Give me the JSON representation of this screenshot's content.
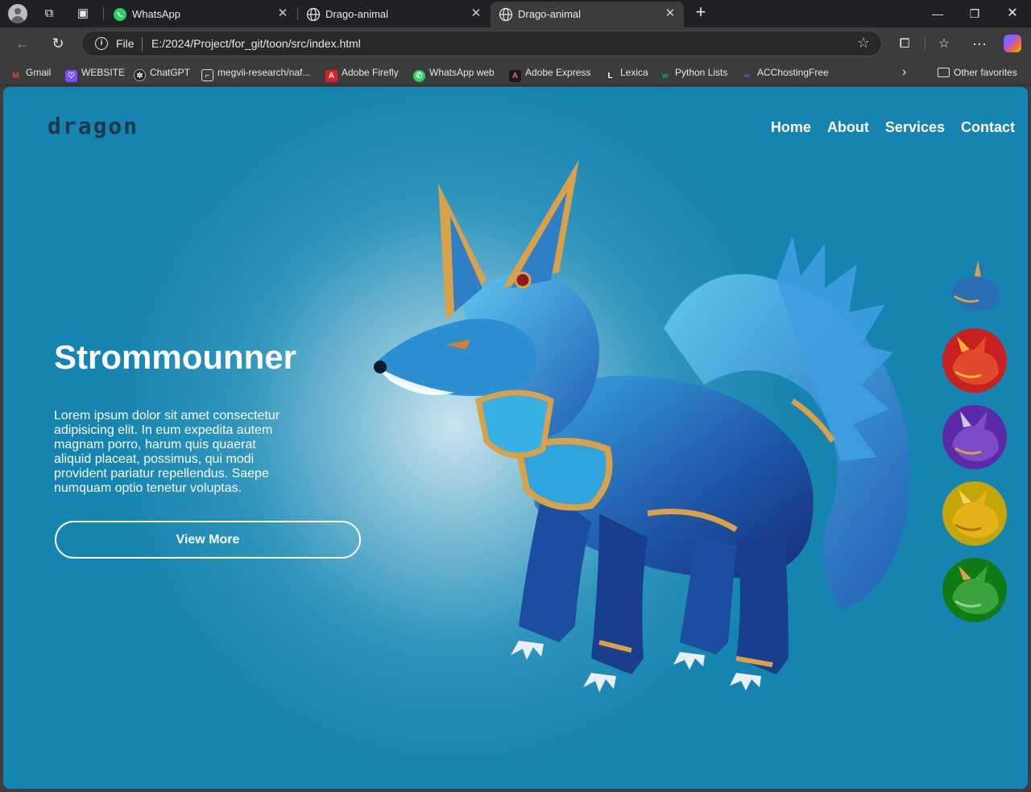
{
  "browser": {
    "tabs": [
      {
        "label": "WhatsApp",
        "icon": "whatsapp-icon"
      },
      {
        "label": "Drago-animal",
        "icon": "globe-icon"
      },
      {
        "label": "Drago-animal",
        "icon": "globe-icon",
        "active": true
      }
    ],
    "address": {
      "scheme": "File",
      "url": "E:/2024/Project/for_git/toon/src/index.html"
    },
    "bookmarks": [
      {
        "label": "Gmail",
        "icon": "gmail-icon",
        "color": "#ea4335"
      },
      {
        "label": "WEBSITE",
        "icon": "website-icon",
        "color": "#7c4dff"
      },
      {
        "label": "ChatGPT",
        "icon": "chatgpt-icon",
        "color": "#1a1a1a"
      },
      {
        "label": "megvii-research/naf...",
        "icon": "github-icon",
        "color": "#555555"
      },
      {
        "label": "Adobe Firefly",
        "icon": "adobe-firefly-icon",
        "color": "#e31e24"
      },
      {
        "label": "WhatsApp web",
        "icon": "whatsapp-icon",
        "color": "#25d366"
      },
      {
        "label": "Adobe Express",
        "icon": "adobe-express-icon",
        "color": "#1a1a1a"
      },
      {
        "label": "Lexica",
        "icon": "lexica-icon",
        "color": "#3c3c3c"
      },
      {
        "label": "Python Lists",
        "icon": "w3schools-icon",
        "color": "#04aa6d"
      },
      {
        "label": "ACChostingFree",
        "icon": "acc-icon",
        "color": "#6a3fb8"
      }
    ],
    "other_favorites": "Other favorites"
  },
  "page": {
    "logo": "dragon",
    "nav": [
      "Home",
      "About",
      "Services",
      "Contact"
    ],
    "hero": {
      "title": "Strommounner",
      "text": "Lorem ipsum dolor sit amet consectetur adipisicing elit. In eum expedita autem magnam porro, harum quis quaerat aliquid placeat, possimus, qui modi provident pariatur repellendus. Saepe numquam optio tenetur voluptas.",
      "button": "View More"
    },
    "thumbnails": [
      {
        "name": "blue-dragon",
        "bg": "transparent",
        "body": "#2a6fb5"
      },
      {
        "name": "red-dragon",
        "bg": "#c81f1f",
        "body": "#e04a2a"
      },
      {
        "name": "purple-dragon",
        "bg": "#5b2aa8",
        "body": "#7c4bc9"
      },
      {
        "name": "yellow-dragon",
        "bg": "#c2a60a",
        "body": "#e5b21a"
      },
      {
        "name": "green-dragon",
        "bg": "#107a16",
        "body": "#3aa33e"
      }
    ],
    "colors": {
      "background": "#1584b0",
      "logo": "#1d3a48",
      "text": "#ffffff"
    }
  }
}
